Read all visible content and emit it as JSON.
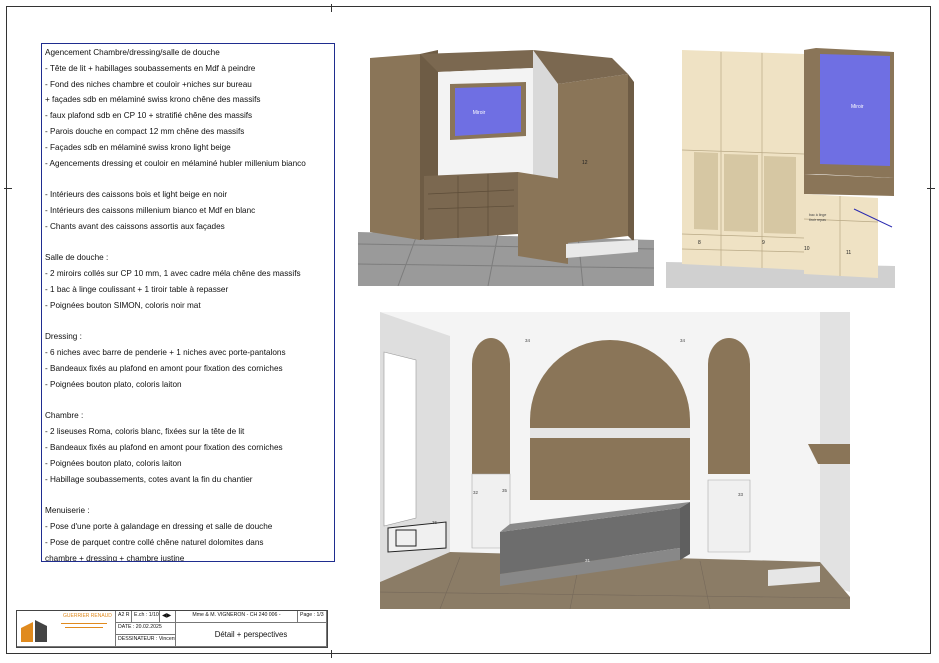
{
  "notes": {
    "lines": [
      "Agencement Chambre/dressing/salle de douche",
      "- Tête de lit + habillages soubassements en Mdf à peindre",
      "- Fond des niches chambre et couloir +niches sur bureau",
      "+ façades sdb en mélaminé swiss krono chêne des massifs",
      "- faux plafond sdb en CP 10 + stratifié chêne des massifs",
      "- Parois douche en compact 12 mm chêne des massifs",
      "- Façades sdb en mélaminé swiss krono light beige",
      "- Agencements dressing et couloir en mélaminé hubler millenium bianco",
      "",
      "- Intérieurs des caissons bois et light beige en noir",
      "- Intérieurs des caissons millenium bianco et Mdf en blanc",
      "- Chants avant des caissons assortis aux façades",
      "",
      "Salle de douche :",
      "- 2 miroirs collés sur CP 10 mm, 1 avec cadre méla chêne des massifs",
      "- 1 bac à linge coulissant + 1 tiroir table à repasser",
      "- Poignées bouton SIMON, coloris noir mat",
      "",
      "Dressing :",
      "- 6 niches avec barre de penderie + 1 niches avec porte-pantalons",
      "- Bandeaux fixés au plafond en amont pour fixation des corniches",
      "- Poignées bouton plato, coloris laiton",
      "",
      "Chambre :",
      "- 2 liseuses Roma, coloris blanc, fixées sur la tête de lit",
      "- Bandeaux fixés au plafond en amont pour fixation des corniches",
      "- Poignées bouton plato, coloris laiton",
      "- Habillage soubassements, cotes avant la fin du chantier",
      "",
      "Menuiserie :",
      "- Pose d'une porte à galandage en dressing et salle de douche",
      "- Pose de parquet contre collé chêne naturel dolomites dans",
      "chambre + dressing + chambre justine"
    ]
  },
  "views": {
    "view1": {
      "mirror_label": "Miroir",
      "label_12": "12"
    },
    "view2": {
      "mirror_label": "Miroir",
      "label_8": "8",
      "label_10": "10",
      "label_11": "11",
      "label_9": "9",
      "tag_text": "bac à linge",
      "tag_text2": "tiroir repas"
    },
    "view3": {
      "label_34a": "34",
      "label_34b": "34",
      "label_32": "32",
      "label_33": "33",
      "label_36": "36",
      "label_31": "31",
      "label_35": "35"
    }
  },
  "title_block": {
    "company": "GUERRIER RENAUD",
    "scale_a": "A2 R",
    "scale_b": "E.ch : 1/10",
    "client": "Mme & M. VIGNERON - CH 240 006 -",
    "page": "Page : 1/3",
    "date": "DATE : 20.02.2025",
    "designer": "DESSINATEUR : Vincent",
    "sheet_title": "Détail + perspectives"
  },
  "colors": {
    "wood": "#8a7558",
    "wood_dark": "#6e5c45",
    "mirror": "#6f6fe3",
    "beige": "#efe2c4",
    "floor_grey": "#a6a6a6",
    "parquet": "#8b7c66",
    "notes_border": "#1f2d8f",
    "logo_orange": "#e08a1e"
  }
}
